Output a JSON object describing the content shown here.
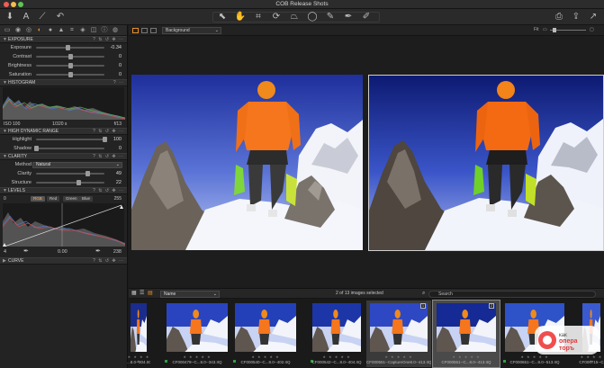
{
  "window": {
    "title": "COB Release Shots"
  },
  "toolbar": {
    "left_tools": [
      {
        "icon": "import-icon",
        "glyph": "⬇"
      },
      {
        "icon": "text-tool-icon",
        "glyph": "A"
      },
      {
        "icon": "brush-icon",
        "glyph": "⟋"
      },
      {
        "icon": "undo-icon",
        "glyph": "↶"
      }
    ],
    "center_tools": [
      {
        "icon": "cursor-icon",
        "glyph": "⬉"
      },
      {
        "icon": "pan-icon",
        "glyph": "✋",
        "active": true
      },
      {
        "icon": "crop-icon",
        "glyph": "⌗"
      },
      {
        "icon": "rotate-icon",
        "glyph": "⟳"
      },
      {
        "icon": "keystone-icon",
        "glyph": "⏢"
      },
      {
        "icon": "spot-removal-icon",
        "glyph": "◯"
      },
      {
        "icon": "mask-brush-icon",
        "glyph": "✎"
      },
      {
        "icon": "picker-icon",
        "glyph": "✒"
      },
      {
        "icon": "eraser-icon",
        "glyph": "✐"
      }
    ],
    "right_tools": [
      {
        "icon": "print-icon",
        "glyph": "⎙"
      },
      {
        "icon": "export-icon",
        "glyph": "⇪"
      },
      {
        "icon": "share-icon",
        "glyph": "↗"
      }
    ]
  },
  "tool_tabs": [
    {
      "icon": "library-tab-icon",
      "glyph": "▭"
    },
    {
      "icon": "capture-tab-icon",
      "glyph": "◉"
    },
    {
      "icon": "lens-tab-icon",
      "glyph": "◎"
    },
    {
      "icon": "exposure-tab-icon",
      "glyph": "◐",
      "active": true
    },
    {
      "icon": "color-tab-icon",
      "glyph": "●"
    },
    {
      "icon": "detail-tab-icon",
      "glyph": "▲"
    },
    {
      "icon": "crop-tab-icon",
      "glyph": "⌗"
    },
    {
      "icon": "local-tab-icon",
      "glyph": "◈"
    },
    {
      "icon": "output-tab-icon",
      "glyph": "◫"
    },
    {
      "icon": "metadata-tab-icon",
      "glyph": "ⓘ"
    },
    {
      "icon": "batch-tab-icon",
      "glyph": "◍"
    }
  ],
  "exposure": {
    "title": "EXPOSURE",
    "rows": [
      {
        "label": "Exposure",
        "pos": 0.46,
        "value": "-0.34"
      },
      {
        "label": "Contrast",
        "pos": 0.5,
        "value": "0"
      },
      {
        "label": "Brightness",
        "pos": 0.5,
        "value": "0"
      },
      {
        "label": "Saturation",
        "pos": 0.5,
        "value": "0"
      }
    ]
  },
  "histogram": {
    "title": "HISTOGRAM",
    "iso": "ISO 100",
    "shutter": "1/320 s",
    "aperture": "f/13"
  },
  "hdr": {
    "title": "HIGH DYNAMIC RANGE",
    "rows": [
      {
        "label": "Highlight",
        "pos": 1.0,
        "value": "100"
      },
      {
        "label": "Shadow",
        "pos": 0.0,
        "value": "0"
      }
    ]
  },
  "clarity": {
    "title": "CLARITY",
    "method_label": "Method",
    "method_value": "Natural",
    "rows": [
      {
        "label": "Clarity",
        "pos": 0.75,
        "value": "49"
      },
      {
        "label": "Structure",
        "pos": 0.62,
        "value": "22"
      }
    ]
  },
  "levels": {
    "title": "LEVELS",
    "min_label": "0",
    "max_label": "255",
    "channels": [
      "RGB",
      "Red",
      "Green",
      "Blue"
    ],
    "active_channel": "RGB",
    "input_low": "4",
    "midpoint": "0.00",
    "input_high": "238"
  },
  "curve": {
    "title": "CURVE"
  },
  "viewer": {
    "background_option": "Background",
    "zoom_label": "Fit"
  },
  "browser": {
    "sort_value": "Name",
    "selection_status": "2 of 13 images selected",
    "search_placeholder": "Search",
    "thumbnails": [
      {
        "name": "...8.0--304.IIQ",
        "state": "normal",
        "badge": "",
        "green": false
      },
      {
        "name": "CF000479--C...8.0--343.IIQ",
        "state": "normal",
        "badge": "",
        "green": true
      },
      {
        "name": "CF000540--C...8.0--402.IIQ",
        "state": "normal",
        "badge": "",
        "green": true
      },
      {
        "name": "CF000542--C...8.0--404.IIQ",
        "state": "normal",
        "badge": "",
        "green": true
      },
      {
        "name": "CF000551--CaptureOne8.0--413.IIQ",
        "state": "selected",
        "badge": "1",
        "green": false
      },
      {
        "name": "CF000551--C...8.0--413.IIQ",
        "state": "primary",
        "badge": "2",
        "green": false
      },
      {
        "name": "CF000651--C...8.0--513.IIQ",
        "state": "normal",
        "badge": "",
        "green": true
      },
      {
        "name": "CF000715--C",
        "state": "normal",
        "badge": "",
        "green": false
      }
    ]
  },
  "watermark": {
    "line1": "как",
    "line2": "опера",
    "line3": "торъ"
  },
  "colors": {
    "accent": "#e8902a",
    "panel": "#232323",
    "viewer_bg": "#1d1d1d"
  }
}
